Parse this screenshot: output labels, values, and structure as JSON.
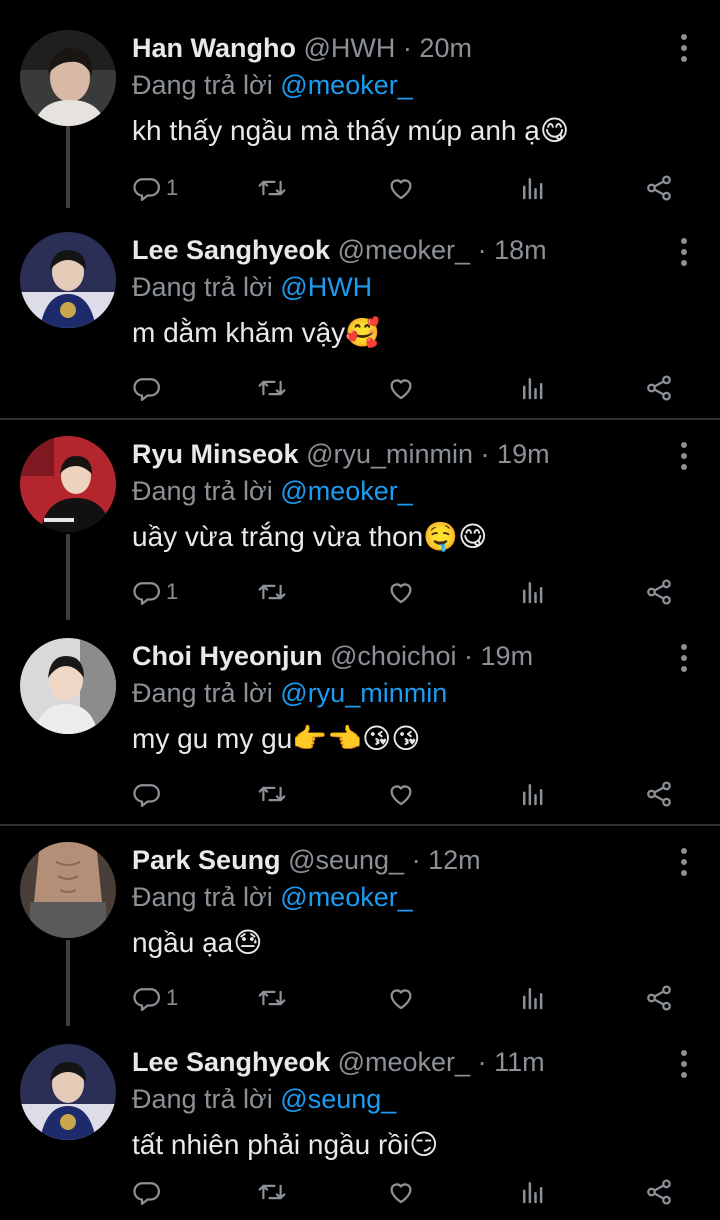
{
  "tweets": [
    {
      "name": "Han Wangho",
      "handle": "@HWH",
      "dot": "·",
      "time": "20m",
      "reply_prefix": "Đang trả lời",
      "reply_to": "@meoker_",
      "text": "kh thấy ngầu mà thấy múp anh ạ😋",
      "reply_count": "1",
      "avatar_icon": "profile-photo"
    },
    {
      "name": "Lee Sanghyeok",
      "handle": "@meoker_",
      "dot": "·",
      "time": "18m",
      "reply_prefix": "Đang trả lời",
      "reply_to": "@HWH",
      "text": "m dằm khăm vậy🥰",
      "reply_count": "",
      "avatar_icon": "profile-photo"
    },
    {
      "name": "Ryu Minseok",
      "handle": "@ryu_minmin",
      "dot": "·",
      "time": "19m",
      "reply_prefix": "Đang trả lời",
      "reply_to": "@meoker_",
      "text": "uầy vừa trắng vừa thon🤤😋",
      "reply_count": "1",
      "avatar_icon": "profile-photo"
    },
    {
      "name": "Choi Hyeonjun",
      "handle": "@choichoi",
      "dot": "·",
      "time": "19m",
      "reply_prefix": "Đang trả lời",
      "reply_to": "@ryu_minmin",
      "text": "my gu my gu👉👈😘😘",
      "reply_count": "",
      "avatar_icon": "profile-photo"
    },
    {
      "name": "Park Seung",
      "handle": "@seung_",
      "dot": "·",
      "time": "12m",
      "reply_prefix": "Đang trả lời",
      "reply_to": "@meoker_",
      "text": "ngầu ạa😓",
      "reply_count": "1",
      "avatar_icon": "profile-photo"
    },
    {
      "name": "Lee Sanghyeok",
      "handle": "@meoker_",
      "dot": "·",
      "time": "11m",
      "reply_prefix": "Đang trả lời",
      "reply_to": "@seung_",
      "text": "tất nhiên phải ngầu rồi😏",
      "reply_count": "",
      "avatar_icon": "profile-photo"
    }
  ],
  "icons": {
    "reply": "reply-icon",
    "retweet": "retweet-icon",
    "like": "heart-icon",
    "stats": "analytics-icon",
    "share": "share-icon",
    "more": "more-vertical-icon"
  },
  "colors": {
    "background": "#000000",
    "text": "#e7e9ea",
    "muted": "#8b9197",
    "link": "#1d9bf0",
    "divider": "#2f3336"
  }
}
